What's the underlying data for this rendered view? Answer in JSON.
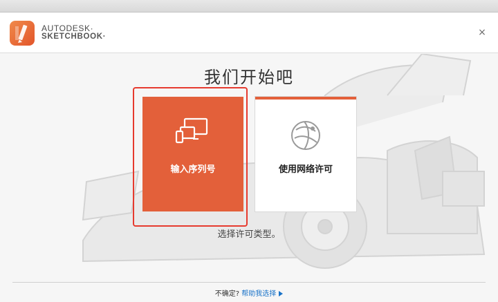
{
  "header": {
    "brand_line1": "AUTODESK·",
    "brand_line2": "SKETCHBOOK·",
    "close_symbol": "×"
  },
  "main": {
    "heading": "我们开始吧",
    "cards": [
      {
        "label": "输入序列号",
        "icon": "devices-icon"
      },
      {
        "label": "使用网络许可",
        "icon": "globe-icon"
      }
    ],
    "subtext": "选择许可类型。"
  },
  "footer": {
    "question": "不确定?",
    "help_link": "帮助我选择"
  },
  "colors": {
    "accent": "#e3603a",
    "highlight_border": "#e63a2e",
    "link": "#1a73c8"
  }
}
